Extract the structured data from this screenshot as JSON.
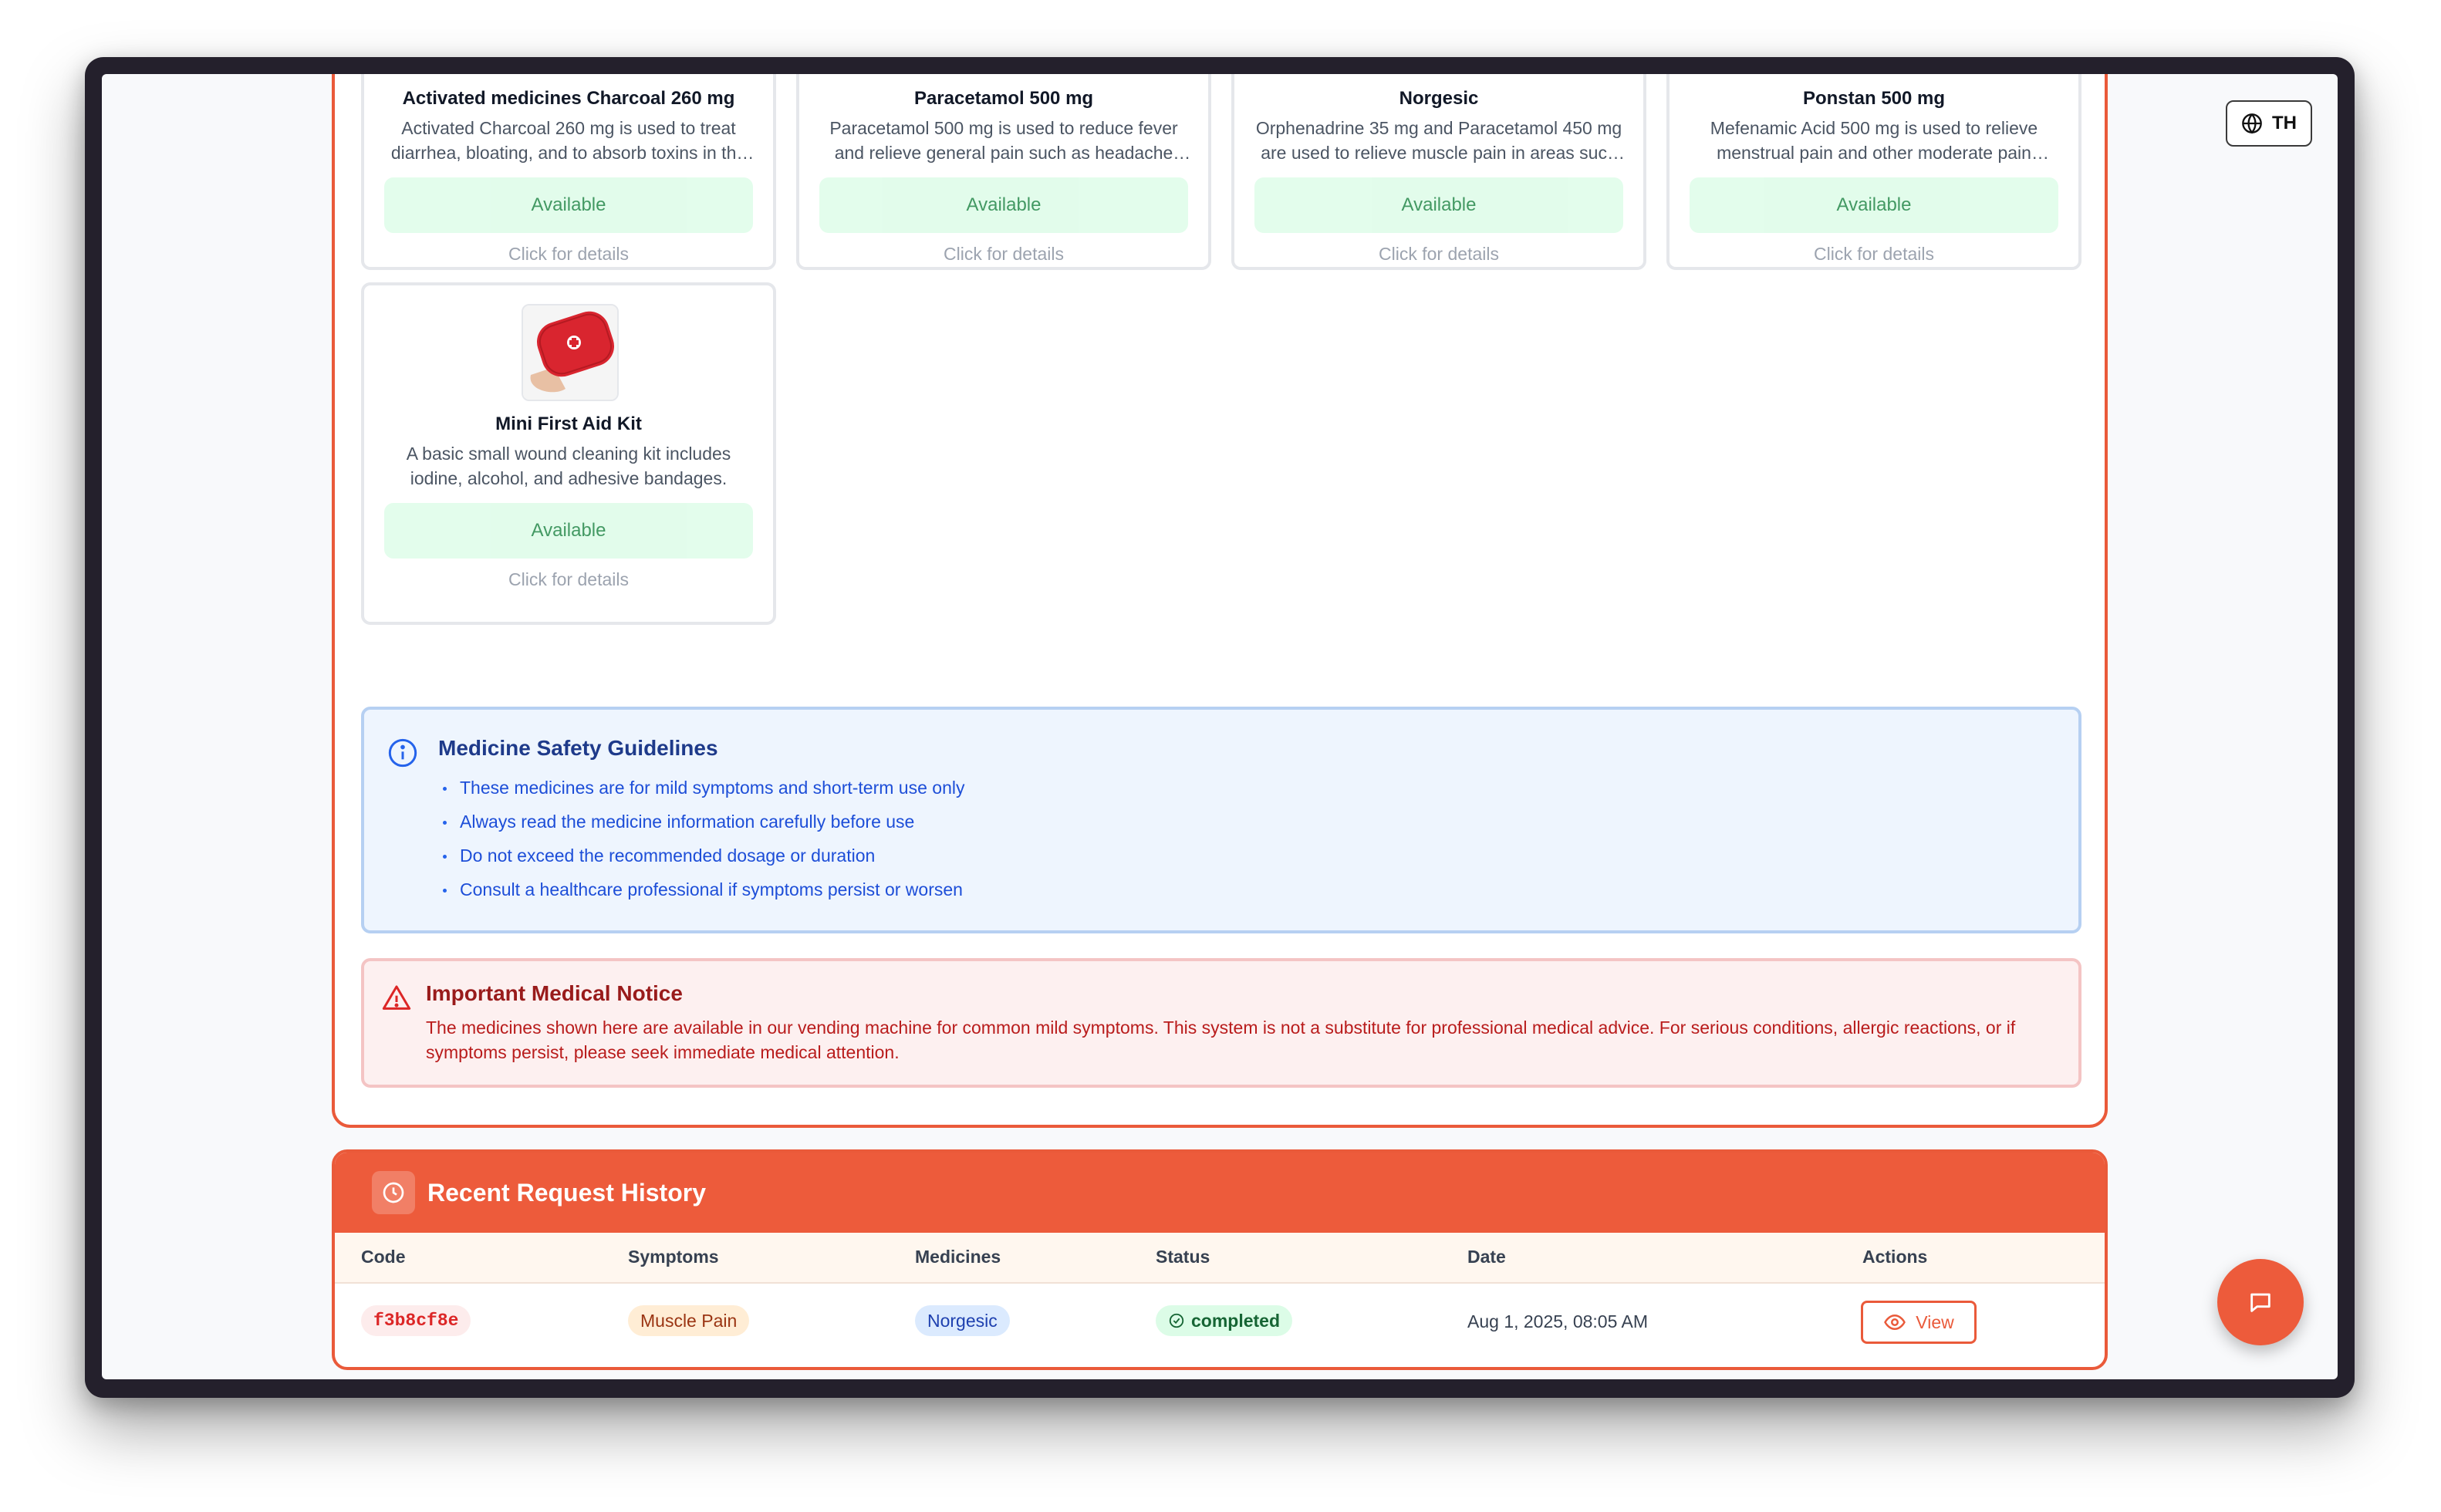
{
  "language_button": {
    "label": "TH",
    "icon": "globe-icon"
  },
  "medicines": [
    {
      "name": "Activated medicines Charcoal 260 mg",
      "description": "Activated Charcoal 260 mg is used to treat diarrhea, bloating, and to absorb toxins in the body",
      "status": "Available",
      "hint": "Click for details"
    },
    {
      "name": "Paracetamol 500 mg",
      "description": "Paracetamol 500 mg is used to reduce fever and relieve general pain such as headache and body aches",
      "status": "Available",
      "hint": "Click for details"
    },
    {
      "name": "Norgesic",
      "description": "Orphenadrine 35 mg and Paracetamol 450 mg are used to relieve muscle pain in areas such as neck and back",
      "status": "Available",
      "hint": "Click for details"
    },
    {
      "name": "Ponstan 500 mg",
      "description": "Mefenamic Acid 500 mg is used to relieve menstrual pain and other moderate pain conditions",
      "status": "Available",
      "hint": "Click for details"
    },
    {
      "name": "Mini First Aid Kit",
      "description": "A basic small wound cleaning kit includes iodine, alcohol, and adhesive bandages.",
      "status": "Available",
      "hint": "Click for details"
    }
  ],
  "safety": {
    "title": "Medicine Safety Guidelines",
    "items": [
      "These medicines are for mild symptoms and short-term use only",
      "Always read the medicine information carefully before use",
      "Do not exceed the recommended dosage or duration",
      "Consult a healthcare professional if symptoms persist or worsen"
    ]
  },
  "notice": {
    "title": "Important Medical Notice",
    "text": "The medicines shown here are available in our vending machine for common mild symptoms. This system is not a substitute for professional medical advice. For serious conditions, allergic reactions, or if symptoms persist, please seek immediate medical attention."
  },
  "history": {
    "title": "Recent Request History",
    "columns": [
      "Code",
      "Symptoms",
      "Medicines",
      "Status",
      "Date",
      "Actions"
    ],
    "rows": [
      {
        "code": "f3b8cf8e",
        "symptoms": "Muscle Pain",
        "medicines": "Norgesic",
        "status": "completed",
        "date": "Aug 1, 2025, 08:05 AM",
        "action": "View"
      }
    ]
  },
  "colors": {
    "accent": "#ed5b3b",
    "available_bg": "#dcfce7",
    "info_bg": "#eef5fe",
    "notice_bg": "#fdf0f0"
  }
}
